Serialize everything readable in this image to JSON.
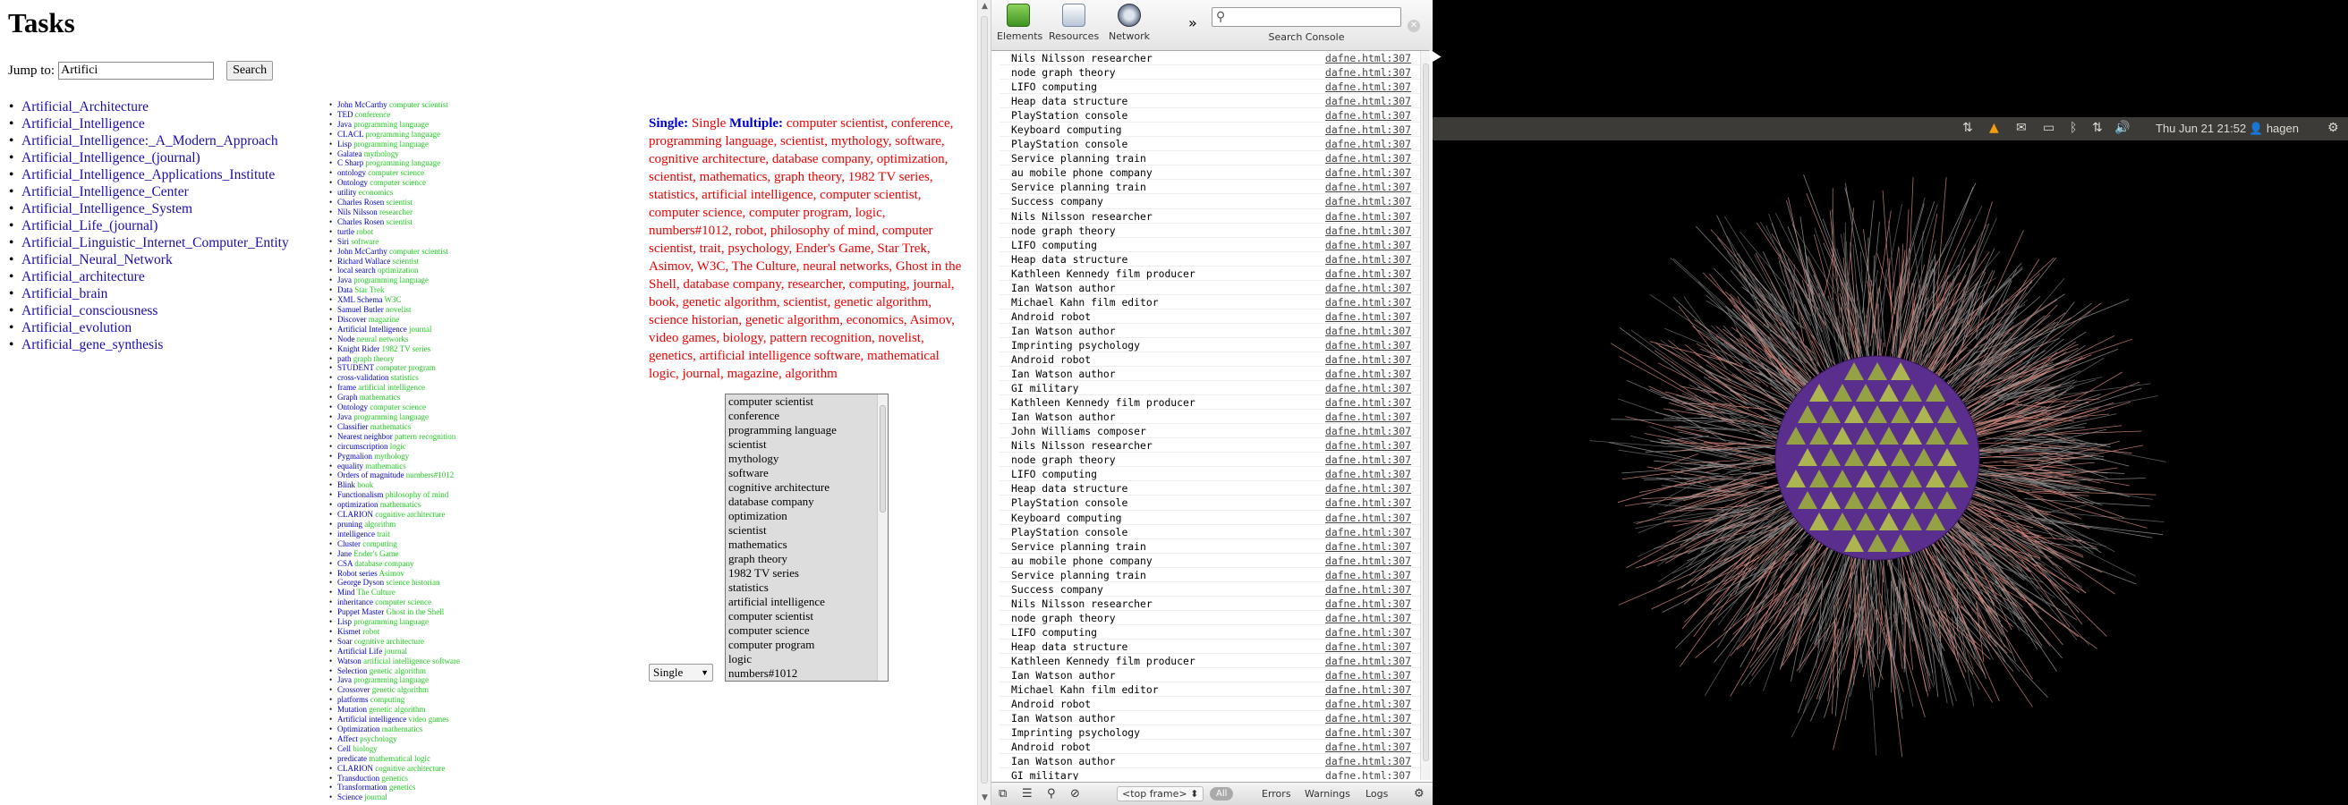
{
  "page": {
    "title": "Tasks",
    "jump_label": "Jump to:",
    "jump_value": "Artifici",
    "search_button": "Search"
  },
  "results": [
    "Artificial_Architecture",
    "Artificial_Intelligence",
    "Artificial_Intelligence:_A_Modern_Approach",
    "Artificial_Intelligence_(journal)",
    "Artificial_Intelligence_Applications_Institute",
    "Artificial_Intelligence_Center",
    "Artificial_Intelligence_System",
    "Artificial_Life_(journal)",
    "Artificial_Linguistic_Internet_Computer_Entity",
    "Artificial_Neural_Network",
    "Artificial_architecture",
    "Artificial_brain",
    "Artificial_consciousness",
    "Artificial_evolution",
    "Artificial_gene_synthesis"
  ],
  "pairs": [
    [
      "John McCarthy",
      "computer scientist"
    ],
    [
      "TED",
      "conference"
    ],
    [
      "Java",
      "programming language"
    ],
    [
      "CLACL",
      "programming language"
    ],
    [
      "Lisp",
      "programming language"
    ],
    [
      "Galatea",
      "mythology"
    ],
    [
      "C Sharp",
      "programming language"
    ],
    [
      "ontology",
      "computer science"
    ],
    [
      "Ontology",
      "computer science"
    ],
    [
      "utility",
      "economics"
    ],
    [
      "Charles Rosen",
      "scientist"
    ],
    [
      "Nils Nilsson",
      "researcher"
    ],
    [
      "Charles Rosen",
      "scientist"
    ],
    [
      "turtle",
      "robot"
    ],
    [
      "Siri",
      "software"
    ],
    [
      "John McCarthy",
      "computer scientist"
    ],
    [
      "Richard Wallace",
      "scientist"
    ],
    [
      "local search",
      "optimization"
    ],
    [
      "Java",
      "programming language"
    ],
    [
      "Data",
      "Star Trek"
    ],
    [
      "XML Schema",
      "W3C"
    ],
    [
      "Samuel Butler",
      "novelist"
    ],
    [
      "Discover",
      "magazine"
    ],
    [
      "Artificial Intelligence",
      "journal"
    ],
    [
      "Node",
      "neural networks"
    ],
    [
      "Knight Rider",
      "1982 TV series"
    ],
    [
      "path",
      "graph theory"
    ],
    [
      "STUDENT",
      "computer program"
    ],
    [
      "cross-validation",
      "statistics"
    ],
    [
      "frame",
      "artificial intelligence"
    ],
    [
      "Graph",
      "mathematics"
    ],
    [
      "Ontology",
      "computer science"
    ],
    [
      "Java",
      "programming language"
    ],
    [
      "Classifier",
      "mathematics"
    ],
    [
      "Nearest neighbor",
      "pattern recognition"
    ],
    [
      "circumscription",
      "logic"
    ],
    [
      "Pygmalion",
      "mythology"
    ],
    [
      "equality",
      "mathematics"
    ],
    [
      "Orders of magnitude",
      "numbers#1012"
    ],
    [
      "Blink",
      "book"
    ],
    [
      "Functionalism",
      "philosophy of mind"
    ],
    [
      "optimization",
      "mathematics"
    ],
    [
      "CLARION",
      "cognitive architecture"
    ],
    [
      "pruning",
      "algorithm"
    ],
    [
      "intelligence",
      "trait"
    ],
    [
      "Cluster",
      "computing"
    ],
    [
      "Jane",
      "Ender's Game"
    ],
    [
      "CSA",
      "database company"
    ],
    [
      "Robot series",
      "Asimov"
    ],
    [
      "George Dyson",
      "science historian"
    ],
    [
      "Mind",
      "The Culture"
    ],
    [
      "inheritance",
      "computer science"
    ],
    [
      "Puppet Master",
      "Ghost in the Shell"
    ],
    [
      "Lisp",
      "programming language"
    ],
    [
      "Kismet",
      "robot"
    ],
    [
      "Soar",
      "cognitive architecture"
    ],
    [
      "Artificial Life",
      "journal"
    ],
    [
      "Watson",
      "artificial intelligence software"
    ],
    [
      "Selection",
      "genetic algorithm"
    ],
    [
      "Java",
      "programming language"
    ],
    [
      "Crossover",
      "genetic algorithm"
    ],
    [
      "platforms",
      "computing"
    ],
    [
      "Mutation",
      "genetic algorithm"
    ],
    [
      "Artificial intelligence",
      "video games"
    ],
    [
      "Optimization",
      "mathematics"
    ],
    [
      "Affect",
      "psychology"
    ],
    [
      "Cell",
      "biology"
    ],
    [
      "predicate",
      "mathematical logic"
    ],
    [
      "CLARION",
      "cognitive architecture"
    ],
    [
      "Transduction",
      "genetics"
    ],
    [
      "Transformation",
      "genetics"
    ],
    [
      "Science",
      "journal"
    ]
  ],
  "single_multiple": {
    "single_label": "Single:",
    "single_value": "Single",
    "multiple_label": "Multiple:",
    "multiple_text": "computer scientist, conference, programming language, scientist, mythology, software, cognitive architecture, database company, optimization, scientist, mathematics, graph theory, 1982 TV series, statistics, artificial intelligence, computer scientist, computer science, computer program, logic, numbers#1012, robot, philosophy of mind, computer scientist, trait, psychology, Ender's Game, Star Trek, Asimov, W3C, The Culture, neural networks, Ghost in the Shell, database company, researcher, computing, journal, book, genetic algorithm, scientist, genetic algorithm, science historian, genetic algorithm, economics, Asimov, video games, biology, pattern recognition, novelist, genetics, artificial intelligence software, mathematical logic, journal, magazine, algorithm"
  },
  "mode_select": {
    "value": "Single",
    "arrow": "▼"
  },
  "listbox_options": [
    "computer scientist",
    "conference",
    "programming language",
    "scientist",
    "mythology",
    "software",
    "cognitive architecture",
    "database company",
    "optimization",
    "scientist",
    "mathematics",
    "graph theory",
    "1982 TV series",
    "statistics",
    "artificial intelligence",
    "computer scientist",
    "computer science",
    "computer program",
    "logic",
    "numbers#1012"
  ],
  "devtools": {
    "tabs": [
      "Elements",
      "Resources",
      "Network"
    ],
    "more": "»",
    "search_label": "Search Console",
    "source": "dafne.html:307",
    "console_lines": [
      "Nils Nilsson researcher",
      "node graph theory",
      "LIFO computing",
      "Heap data structure",
      "PlayStation console",
      "Keyboard computing",
      "PlayStation console",
      "Service planning train",
      "au mobile phone company",
      "Service planning train",
      "Success company",
      "Nils Nilsson researcher",
      "node graph theory",
      "LIFO computing",
      "Heap data structure",
      "Kathleen Kennedy film producer",
      "Ian Watson author",
      "Michael Kahn film editor",
      "Android robot",
      "Ian Watson author",
      "Imprinting psychology",
      "Android robot",
      "Ian Watson author",
      "GI military",
      "Kathleen Kennedy film producer",
      "Ian Watson author",
      "John Williams composer",
      "Nils Nilsson researcher",
      "node graph theory",
      "LIFO computing",
      "Heap data structure",
      "PlayStation console",
      "Keyboard computing",
      "PlayStation console",
      "Service planning train",
      "au mobile phone company",
      "Service planning train",
      "Success company",
      "Nils Nilsson researcher",
      "node graph theory",
      "LIFO computing",
      "Heap data structure",
      "Kathleen Kennedy film producer",
      "Ian Watson author",
      "Michael Kahn film editor",
      "Android robot",
      "Ian Watson author",
      "Imprinting psychology",
      "Android robot",
      "Ian Watson author",
      "GI military"
    ],
    "frame": "<top frame> ⬍",
    "filter_all": "All",
    "filter_errors": "Errors",
    "filter_warnings": "Warnings",
    "filter_logs": "Logs"
  },
  "panel": {
    "clock": "Thu Jun 21 21:52",
    "user": "hagen"
  },
  "colors": {
    "link": "#1a0dab",
    "pair_key": "#0000cc",
    "pair_value": "#22cc22",
    "multiple_text": "#ee0000",
    "panel_bg": "#3c3b37"
  }
}
